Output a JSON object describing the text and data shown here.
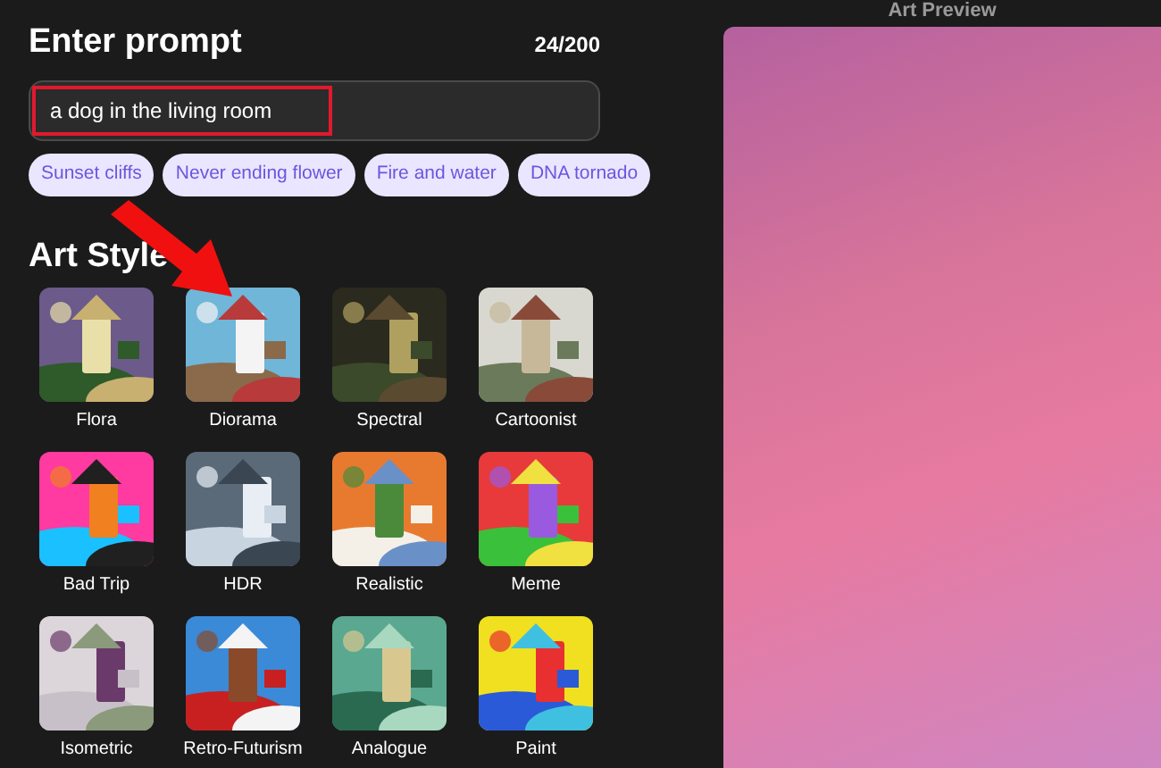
{
  "prompt": {
    "title": "Enter prompt",
    "counter": "24/200",
    "value": "a dog in the living room"
  },
  "suggestions": [
    "Sunset cliffs",
    "Never ending flower",
    "Fire and water",
    "DNA tornado"
  ],
  "art_style": {
    "title": "Art Style",
    "styles": [
      {
        "label": "Flora"
      },
      {
        "label": "Diorama"
      },
      {
        "label": "Spectral"
      },
      {
        "label": "Cartoonist"
      },
      {
        "label": "Bad Trip"
      },
      {
        "label": "HDR"
      },
      {
        "label": "Realistic"
      },
      {
        "label": "Meme"
      },
      {
        "label": "Isometric"
      },
      {
        "label": "Retro-Futurism"
      },
      {
        "label": "Analogue"
      },
      {
        "label": "Paint"
      }
    ]
  },
  "preview": {
    "title": "Art Preview"
  }
}
